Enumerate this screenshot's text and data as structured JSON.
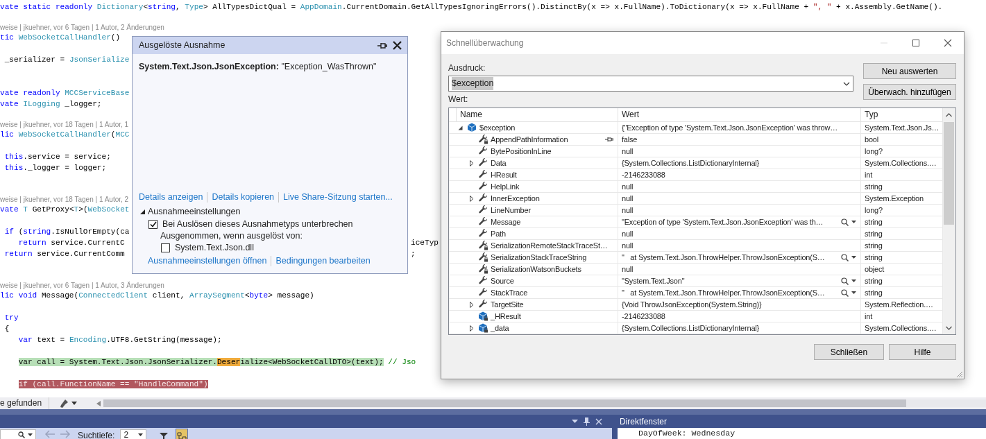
{
  "editor": {
    "lines": [
      {
        "kind": "code",
        "segments": [
          {
            "text": "vate static readonly ",
            "kind": "kw"
          },
          {
            "text": "Dictionary",
            "kind": "type"
          },
          {
            "text": "<",
            "kind": "plain"
          },
          {
            "text": "string",
            "kind": "kw"
          },
          {
            "text": ", ",
            "kind": "plain"
          },
          {
            "text": "Type",
            "kind": "type"
          },
          {
            "text": "> AllTypesDictQual = ",
            "kind": "plain"
          },
          {
            "text": "AppDomain",
            "kind": "type"
          },
          {
            "text": ".CurrentDomain.GetAllTypesIgnoringErrors().DistinctBy(x => x.FullName).ToDictionary(x => x.FullName + ",
            "kind": "plain"
          },
          {
            "text": "\", \"",
            "kind": "str"
          },
          {
            "text": " + x.Assembly.GetName().",
            "kind": "plain"
          }
        ]
      },
      {
        "kind": "blank"
      },
      {
        "kind": "lens",
        "text": "weise | jkuehner, vor 6 Tagen | 1 Autor, 2 Änderungen"
      },
      {
        "kind": "code",
        "segments": [
          {
            "text": "tic ",
            "kind": "kw"
          },
          {
            "text": "WebSocketCallHandler",
            "kind": "type"
          },
          {
            "text": "()",
            "kind": "plain"
          }
        ]
      },
      {
        "kind": "blank"
      },
      {
        "kind": "code",
        "segments": [
          {
            "text": " _serializer = ",
            "kind": "plain"
          },
          {
            "text": "JsonSerialize",
            "kind": "type"
          }
        ]
      },
      {
        "kind": "blank"
      },
      {
        "kind": "blank"
      },
      {
        "kind": "code",
        "segments": [
          {
            "text": "vate readonly ",
            "kind": "kw"
          },
          {
            "text": "MCCServiceBase",
            "kind": "type"
          }
        ]
      },
      {
        "kind": "code",
        "segments": [
          {
            "text": "vate ",
            "kind": "kw"
          },
          {
            "text": "ILogging",
            "kind": "type"
          },
          {
            "text": " _logger;",
            "kind": "plain"
          }
        ]
      },
      {
        "kind": "blank"
      },
      {
        "kind": "lens",
        "text": "weise | jkuehner, vor 18 Tagen | 1 Autor, 1"
      },
      {
        "kind": "code",
        "segments": [
          {
            "text": "lic ",
            "kind": "kw"
          },
          {
            "text": "WebSocketCallHandler",
            "kind": "type"
          },
          {
            "text": "(",
            "kind": "plain"
          },
          {
            "text": "MCC",
            "kind": "type"
          }
        ]
      },
      {
        "kind": "blank"
      },
      {
        "kind": "code",
        "segments": [
          {
            "text": " this",
            "kind": "kw"
          },
          {
            "text": ".service = service;",
            "kind": "plain"
          }
        ]
      },
      {
        "kind": "code",
        "segments": [
          {
            "text": " this",
            "kind": "kw"
          },
          {
            "text": "._logger = logger;",
            "kind": "plain"
          }
        ]
      },
      {
        "kind": "blank"
      },
      {
        "kind": "blank"
      },
      {
        "kind": "lens",
        "text": "weise | jkuehner, vor 18 Tagen | 1 Autor, 2"
      },
      {
        "kind": "code",
        "segments": [
          {
            "text": "vate ",
            "kind": "kw"
          },
          {
            "text": "T",
            "kind": "type"
          },
          {
            "text": " GetProxy<",
            "kind": "plain"
          },
          {
            "text": "T",
            "kind": "type"
          },
          {
            "text": ">(",
            "kind": "plain"
          },
          {
            "text": "WebSocket",
            "kind": "type"
          }
        ]
      },
      {
        "kind": "blank"
      },
      {
        "kind": "code",
        "segments": [
          {
            "text": " if",
            "kind": "kw"
          },
          {
            "text": " (",
            "kind": "plain"
          },
          {
            "text": "string",
            "kind": "kw"
          },
          {
            "text": ".IsNullOrEmpty(ca",
            "kind": "plain"
          }
        ]
      },
      {
        "kind": "code",
        "segments": [
          {
            "text": "    return",
            "kind": "kw"
          },
          {
            "text": " service.CurrentC",
            "kind": "plain"
          }
        ],
        "after_popup": [
          {
            "text": "iceTyp",
            "kind": "plain"
          }
        ]
      },
      {
        "kind": "code",
        "segments": [
          {
            "text": " return",
            "kind": "kw"
          },
          {
            "text": " service.CurrentComm",
            "kind": "plain"
          }
        ],
        "after_popup": [
          {
            "text": ";",
            "kind": "plain"
          }
        ]
      },
      {
        "kind": "blank"
      },
      {
        "kind": "blank"
      },
      {
        "kind": "lens",
        "text": "weise | jkuehner, vor 6 Tagen | 1 Autor, 3 Änderungen"
      },
      {
        "kind": "code",
        "segments": [
          {
            "text": "lic void ",
            "kind": "kw"
          },
          {
            "text": "Message(",
            "kind": "plain"
          },
          {
            "text": "ConnectedClient",
            "kind": "type"
          },
          {
            "text": " client, ",
            "kind": "plain"
          },
          {
            "text": "ArraySegment",
            "kind": "type"
          },
          {
            "text": "<",
            "kind": "plain"
          },
          {
            "text": "byte",
            "kind": "kw"
          },
          {
            "text": "> message)",
            "kind": "plain"
          }
        ]
      },
      {
        "kind": "blank"
      },
      {
        "kind": "code",
        "segments": [
          {
            "text": " try",
            "kind": "kw"
          }
        ]
      },
      {
        "kind": "code",
        "segments": [
          {
            "text": " {",
            "kind": "plain"
          }
        ]
      },
      {
        "kind": "code",
        "segments": [
          {
            "text": "    var",
            "kind": "kw"
          },
          {
            "text": " text = ",
            "kind": "plain"
          },
          {
            "text": "Encoding",
            "kind": "type"
          },
          {
            "text": ".UTF8.GetString(message);",
            "kind": "plain"
          }
        ]
      },
      {
        "kind": "blank"
      },
      {
        "kind": "code",
        "segments": [
          {
            "text": "    var call = System.Text.Json.JsonSerializer.",
            "kind": "statement"
          },
          {
            "text": "Deser",
            "kind": "match"
          },
          {
            "text": "ialize<WebSocketCallDTO>(text);",
            "kind": "statement"
          },
          {
            "text": " // Jso",
            "kind": "comment"
          }
        ]
      },
      {
        "kind": "blank"
      },
      {
        "kind": "code",
        "segments": [
          {
            "text": "    if (call.FunctionName == \"HandleCommand\")",
            "kind": "breakpoint"
          }
        ]
      }
    ]
  },
  "find_bar": {
    "status": "e gefunden"
  },
  "exception_popup": {
    "title": "Ausgelöste Ausnahme",
    "message": "**System.Text.Json.JsonException:** \"Exception_WasThrown\"",
    "links": [
      "Details anzeigen",
      "Details kopieren",
      "Live Share-Sitzung starten..."
    ],
    "settings": {
      "title": "Ausnahmeeinstellungen",
      "expanded": true,
      "break_option": {
        "label": "Bei Auslösen dieses Ausnahmetyps unterbrechen",
        "checked": true
      },
      "exception_label": "Ausgenommen, wenn ausgelöst von:",
      "modules": [
        {
          "label": "System.Text.Json.dll",
          "checked": false
        }
      ],
      "links": [
        "Ausnahmeeinstellungen öffnen",
        "Bedingungen bearbeiten"
      ]
    }
  },
  "quick_watch": {
    "title": "Schnellüberwachung",
    "expression_label": "Ausdruck:",
    "expression": "$exception",
    "expression_selected": true,
    "side_buttons": [
      "Neu auswerten",
      "Überwach. hinzufügen"
    ],
    "value_label": "Wert:",
    "columns": [
      "Name",
      "Wert",
      "Typ"
    ],
    "rows": [
      {
        "name": "$exception",
        "kind": "object",
        "expandable": true,
        "expanded": true,
        "value": "{\"Exception of type 'System.Text.Json.JsonException' was throw…",
        "type": "System.Text.Json.Js…",
        "viewer": false,
        "pinned": false,
        "children": [
          {
            "name": "AppendPathInformation",
            "kind": "private-property",
            "expandable": false,
            "value": "false",
            "type": "bool",
            "viewer": false,
            "pinned": true
          },
          {
            "name": "BytePositionInLine",
            "kind": "property",
            "expandable": false,
            "value": "null",
            "type": "long?",
            "viewer": false,
            "pinned": false
          },
          {
            "name": "Data",
            "kind": "property",
            "expandable": true,
            "expanded": false,
            "value": "{System.Collections.ListDictionaryInternal}",
            "type": "System.Collections.…",
            "viewer": false,
            "pinned": false
          },
          {
            "name": "HResult",
            "kind": "property",
            "expandable": false,
            "value": "-2146233088",
            "type": "int",
            "viewer": false,
            "pinned": false
          },
          {
            "name": "HelpLink",
            "kind": "property",
            "expandable": false,
            "value": "null",
            "type": "string",
            "viewer": false,
            "pinned": false
          },
          {
            "name": "InnerException",
            "kind": "property",
            "expandable": true,
            "expanded": false,
            "value": "null",
            "type": "System.Exception",
            "viewer": false,
            "pinned": false
          },
          {
            "name": "LineNumber",
            "kind": "property",
            "expandable": false,
            "value": "null",
            "type": "long?",
            "viewer": false,
            "pinned": false
          },
          {
            "name": "Message",
            "kind": "property",
            "expandable": false,
            "value": "\"Exception of type 'System.Text.Json.JsonException' was th…",
            "type": "string",
            "viewer": true,
            "pinned": false
          },
          {
            "name": "Path",
            "kind": "property",
            "expandable": false,
            "value": "null",
            "type": "string",
            "viewer": false,
            "pinned": false
          },
          {
            "name": "SerializationRemoteStackTraceSt…",
            "kind": "private-property",
            "expandable": false,
            "value": "null",
            "type": "string",
            "viewer": false,
            "pinned": false
          },
          {
            "name": "SerializationStackTraceString",
            "kind": "private-property",
            "expandable": false,
            "value": "\"   at System.Text.Json.ThrowHelper.ThrowJsonException(S…",
            "type": "string",
            "viewer": true,
            "pinned": false
          },
          {
            "name": "SerializationWatsonBuckets",
            "kind": "private-property",
            "expandable": false,
            "value": "null",
            "type": "object",
            "viewer": false,
            "pinned": false
          },
          {
            "name": "Source",
            "kind": "property",
            "expandable": false,
            "value": "\"System.Text.Json\"",
            "type": "string",
            "viewer": true,
            "pinned": false
          },
          {
            "name": "StackTrace",
            "kind": "property",
            "expandable": false,
            "value": "\"   at System.Text.Json.ThrowHelper.ThrowJsonException(S…",
            "type": "string",
            "viewer": true,
            "pinned": false
          },
          {
            "name": "TargetSite",
            "kind": "property",
            "expandable": true,
            "expanded": false,
            "value": "{Void ThrowJsonException(System.String)}",
            "type": "System.Reflection.…",
            "viewer": false,
            "pinned": false
          },
          {
            "name": "_HResult",
            "kind": "private-field",
            "expandable": false,
            "value": "-2146233088",
            "type": "int",
            "viewer": false,
            "pinned": false
          },
          {
            "name": "_data",
            "kind": "private-field",
            "expandable": true,
            "expanded": false,
            "value": "{System.Collections.ListDictionaryInternal}",
            "type": "System.Collections.…",
            "viewer": false,
            "pinned": false
          }
        ]
      }
    ],
    "footer_buttons": [
      "Schließen",
      "Hilfe"
    ]
  },
  "locals_toolbar": {
    "nav": [
      {
        "disabled": true
      },
      {
        "disabled": true
      }
    ],
    "depth_label": "Suchtiefe:",
    "depth": "2",
    "toggles": [
      {
        "pressed": false
      },
      {
        "pressed": true
      }
    ]
  },
  "immediate_window": {
    "title": "Direktfenster",
    "lines": [
      "DayOfWeek: Wednesday"
    ]
  }
}
